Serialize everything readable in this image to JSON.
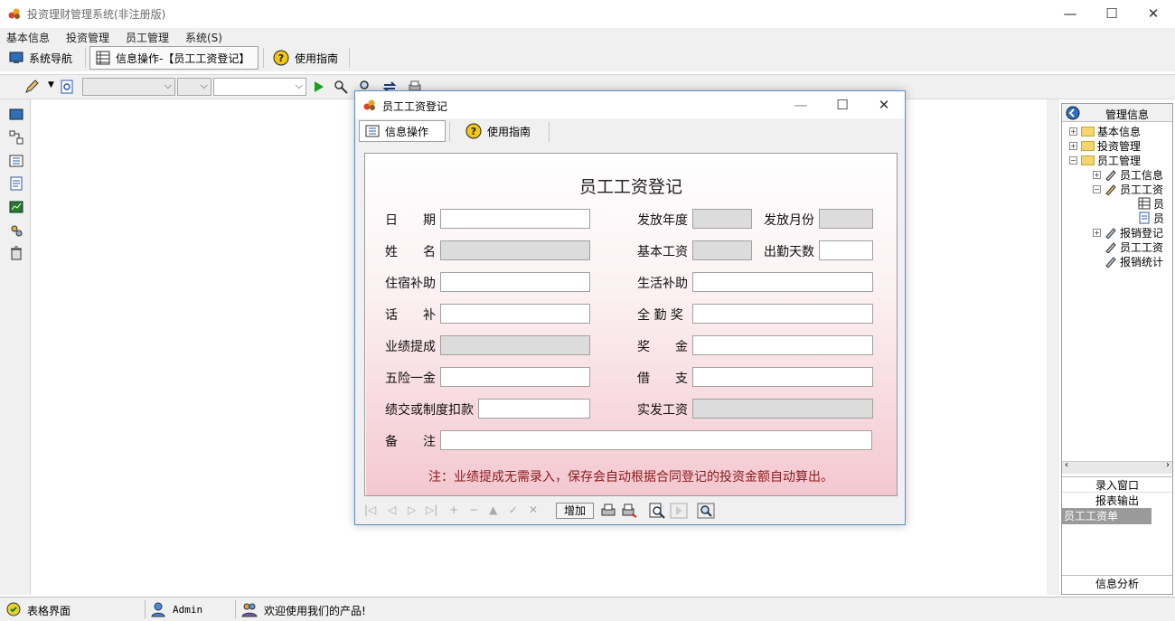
{
  "window": {
    "title": "投资理财管理系统(非注册版)"
  },
  "menubar": {
    "items": [
      "基本信息",
      "投资管理",
      "员工管理",
      "系统(S)"
    ]
  },
  "tabs": [
    {
      "label": "系统导航"
    },
    {
      "label": "信息操作-【员工工资登记】"
    },
    {
      "label": "使用指南"
    }
  ],
  "toolbar": {
    "combo1": "",
    "combo2": "",
    "combo3": ""
  },
  "right_panel": {
    "header": "管理信息",
    "tree": [
      {
        "label": "基本信息"
      },
      {
        "label": "投资管理"
      },
      {
        "label": "员工管理"
      },
      {
        "label": "员工信息"
      },
      {
        "label": "员工工资"
      },
      {
        "label": "员"
      },
      {
        "label": "员"
      },
      {
        "label": "报销登记"
      },
      {
        "label": "员工工资"
      },
      {
        "label": "报销统计"
      }
    ],
    "list": [
      "录入窗口",
      "报表输出",
      "员工工资单"
    ],
    "footer": "信息分析"
  },
  "status": {
    "view": "表格界面",
    "user": "Admin",
    "message": "欢迎使用我们的产品!"
  },
  "dialog": {
    "title": "员工工资登记",
    "tabs": [
      "信息操作",
      "使用指南"
    ],
    "form_title": "员工工资登记",
    "fields": {
      "date": "日　　期",
      "year": "发放年度",
      "month": "发放月份",
      "name": "姓　　名",
      "base_salary": "基本工资",
      "attendance": "出勤天数",
      "housing": "住宿补助",
      "living": "生活补助",
      "phone": "话　　补",
      "full_attendance": "全 勤 奖",
      "commission": "业绩提成",
      "bonus": "奖　　金",
      "insurance": "五险一金",
      "loan": "借　　支",
      "deduction": "绩交或制度扣款",
      "actual": "实发工资",
      "remark": "备　　注"
    },
    "note": "注：业绩提成无需录入，保存会自动根据合同登记的投资金额自动算出。",
    "add_button": "增加"
  }
}
